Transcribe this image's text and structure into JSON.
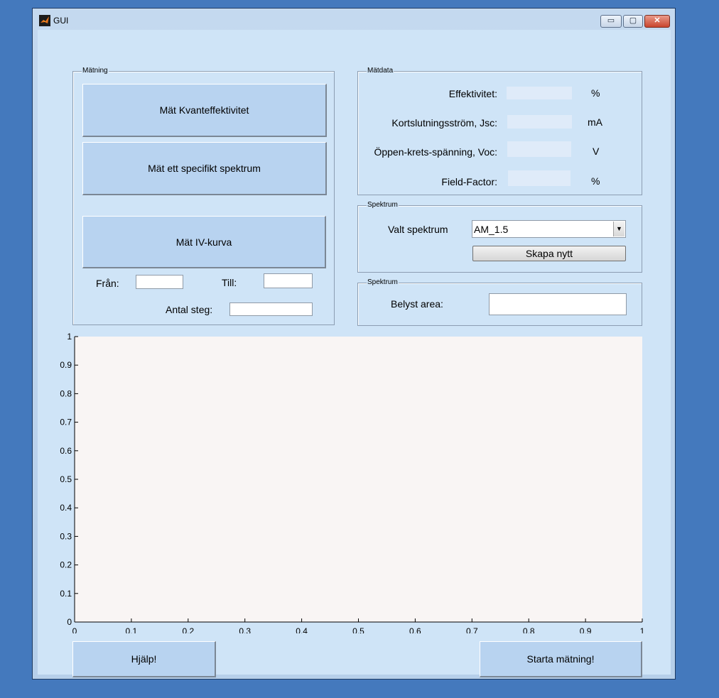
{
  "window": {
    "title": "GUI",
    "controls": {
      "minimize": "▭",
      "maximize": "▢",
      "close": "✕"
    }
  },
  "matning": {
    "title": "Mätning",
    "btn_kvant": "Mät Kvanteffektivitet",
    "btn_spektrum": "Mät ett specifikt spektrum",
    "btn_iv": "Mät IV-kurva",
    "fran_label": "Från:",
    "fran_value": "",
    "till_label": "Till:",
    "till_value": "",
    "steg_label": "Antal steg:",
    "steg_value": ""
  },
  "matdata": {
    "title": "Mätdata",
    "rows": [
      {
        "label": "Effektivitet:",
        "value": "",
        "unit": "%"
      },
      {
        "label": "Kortslutningsström, Jsc:",
        "value": "",
        "unit": "mA"
      },
      {
        "label": "Öppen-krets-spänning, Voc:",
        "value": "",
        "unit": "V"
      },
      {
        "label": "Field-Factor:",
        "value": "",
        "unit": "%"
      }
    ]
  },
  "spektrum": {
    "title": "Spektrum",
    "label": "Valt spektrum",
    "selected": "AM_1.5",
    "create_button": "Skapa nytt"
  },
  "area": {
    "title": "Spektrum",
    "label": "Belyst area:",
    "value": ""
  },
  "chart_data": {
    "type": "line",
    "title": "",
    "xlabel": "",
    "ylabel": "",
    "xlim": [
      0,
      1
    ],
    "ylim": [
      0,
      1
    ],
    "x_ticks": [
      "0",
      "0.1",
      "0.2",
      "0.3",
      "0.4",
      "0.5",
      "0.6",
      "0.7",
      "0.8",
      "0.9",
      "1"
    ],
    "y_ticks": [
      "0",
      "0.1",
      "0.2",
      "0.3",
      "0.4",
      "0.5",
      "0.6",
      "0.7",
      "0.8",
      "0.9",
      "1"
    ],
    "series": [],
    "grid": false,
    "background": "#f9f5f4"
  },
  "footer": {
    "help_button": "Hjälp!",
    "start_button": "Starta mätning!"
  },
  "colors": {
    "desktop": "#4479bd",
    "client": "#cfe4f7",
    "button": "#b8d3f0",
    "plot_bg": "#f9f5f4"
  }
}
